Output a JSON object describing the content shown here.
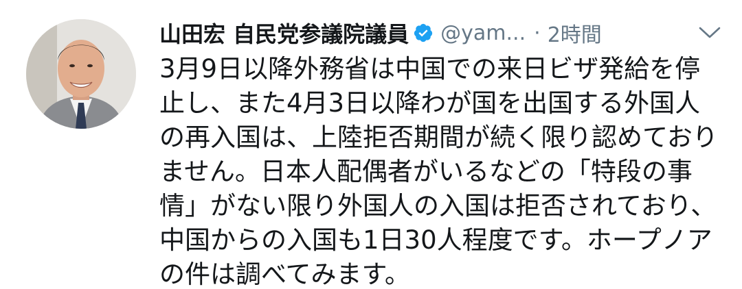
{
  "tweet": {
    "author_name": "山田宏 自民党参議院議員",
    "handle": "@yam...",
    "separator": "·",
    "time": "2時間",
    "text": "3月9日以降外務省は中国での来日ビザ発給を停止し、また4月3日以降わが国を出国する外国人の再入国は、上陸拒否期間が続く限り認めておりません。日本人配偶者がいるなどの「特段の事情」がない限り外国人の入国は拒否されており、中国からの入国も1日30人程度です。ホープノアの件は調べてみます。"
  },
  "icons": {
    "verified": "verified-badge-icon",
    "more": "chevron-down-icon"
  },
  "colors": {
    "text_primary": "#14171a",
    "text_secondary": "#657786",
    "verified_blue": "#1da1f2",
    "background": "#ffffff"
  }
}
